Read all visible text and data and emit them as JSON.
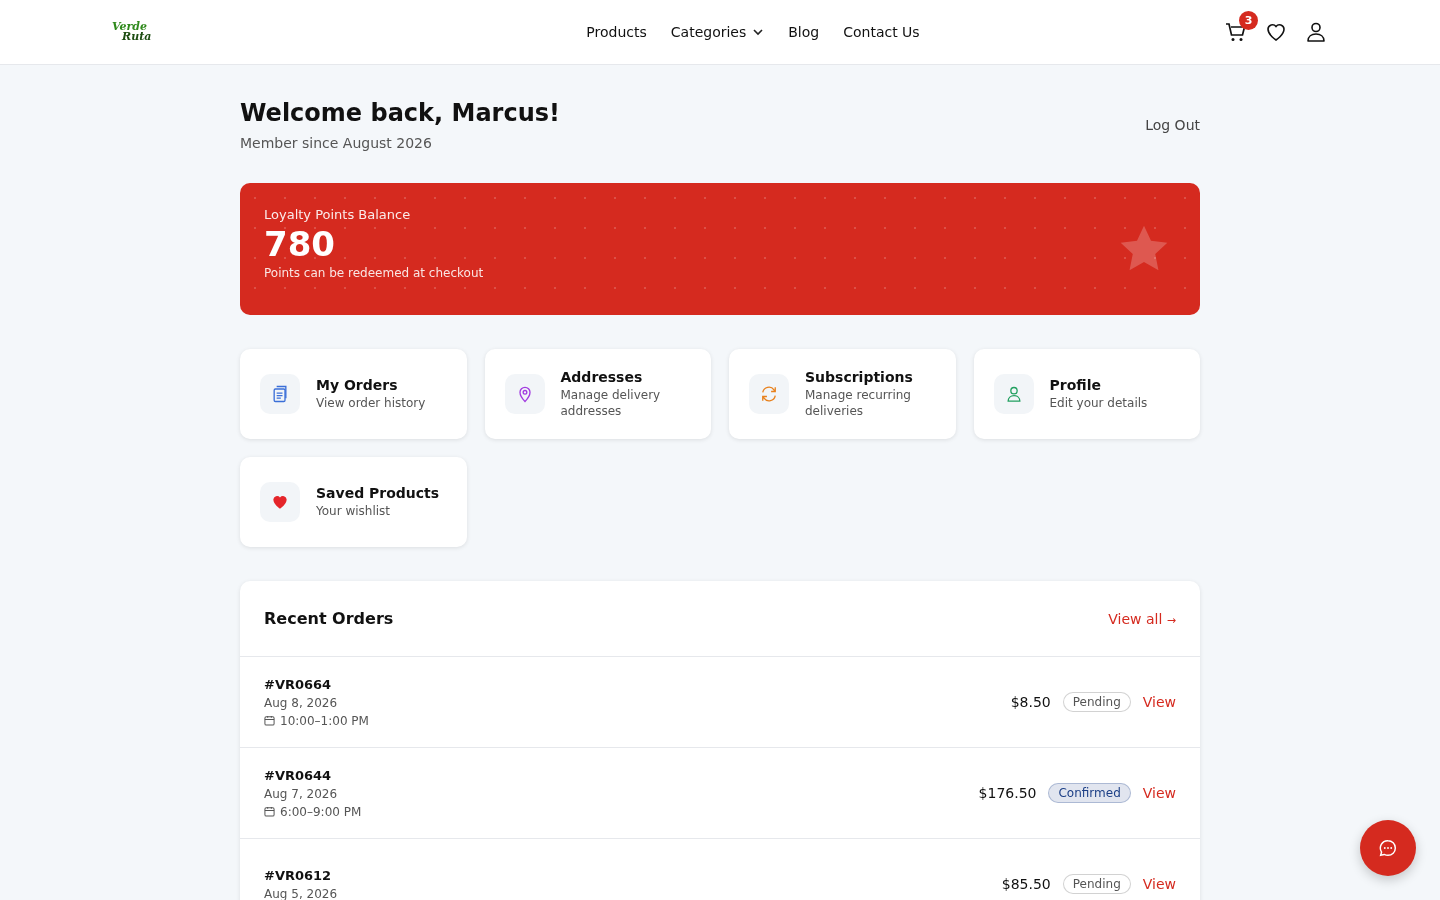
{
  "header": {
    "logo": [
      "Verde",
      "Ruta"
    ],
    "nav": [
      {
        "label": "Products",
        "dropdown": false
      },
      {
        "label": "Categories",
        "dropdown": true
      },
      {
        "label": "Blog",
        "dropdown": false
      },
      {
        "label": "Contact Us",
        "dropdown": false
      }
    ],
    "cart_count": "3"
  },
  "welcome": {
    "title": "Welcome back, Marcus!",
    "subtitle": "Member since August 2026",
    "logout": "Log Out"
  },
  "loyalty": {
    "label": "Loyalty Points Balance",
    "points": "780",
    "note": "Points can be redeemed at checkout"
  },
  "cards": [
    {
      "kind": "orders",
      "title": "My Orders",
      "subtitle": "View order history"
    },
    {
      "kind": "addresses",
      "title": "Addresses",
      "subtitle": "Manage delivery addresses"
    },
    {
      "kind": "subscriptions",
      "title": "Subscriptions",
      "subtitle": "Manage recurring deliveries"
    },
    {
      "kind": "profile",
      "title": "Profile",
      "subtitle": "Edit your details"
    },
    {
      "kind": "saved",
      "title": "Saved Products",
      "subtitle": "Your wishlist"
    }
  ],
  "recent_orders": {
    "title": "Recent Orders",
    "view_all": "View all",
    "view_all_arrow": "→",
    "rows": [
      {
        "id": "#VR0664",
        "date": "Aug 8, 2026",
        "slot": "10:00–1:00 PM",
        "total": "$8.50",
        "status": "Pending",
        "color": "#555555",
        "action": "View"
      },
      {
        "id": "#VR0644",
        "date": "Aug 7, 2026",
        "slot": "6:00–9:00 PM",
        "total": "$176.50",
        "status": "Confirmed",
        "color": "#1c3f86",
        "action": "View"
      },
      {
        "id": "#VR0612",
        "date": "Aug 5, 2026",
        "total": "$85.50",
        "status": "Pending",
        "color": "#555555",
        "action": "View"
      }
    ]
  }
}
